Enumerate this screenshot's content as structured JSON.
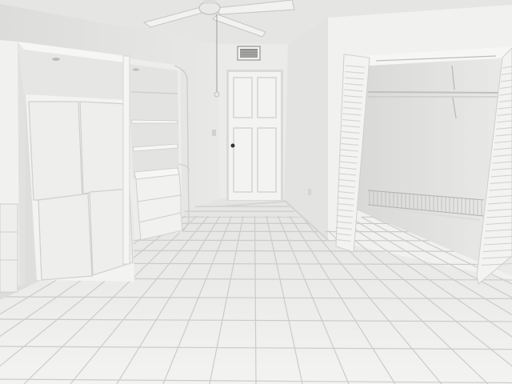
{
  "scene": {
    "description_type": "photo",
    "colors": {
      "ceiling": "#e6e6e4",
      "wall_left": "#e2e2e0",
      "wall_back": "#ececea",
      "wall_right": "#f1f1ef",
      "floor": "#ececea",
      "grout": "#c9c9c7",
      "cabinet": "#f4f4f2",
      "cabinet_shadow": "#d6d6d4",
      "door": "#f2f2f0",
      "closet_interior": "#e4e4e2",
      "fan_blade": "#f0f0ee",
      "vent": "#9a9a98"
    }
  }
}
